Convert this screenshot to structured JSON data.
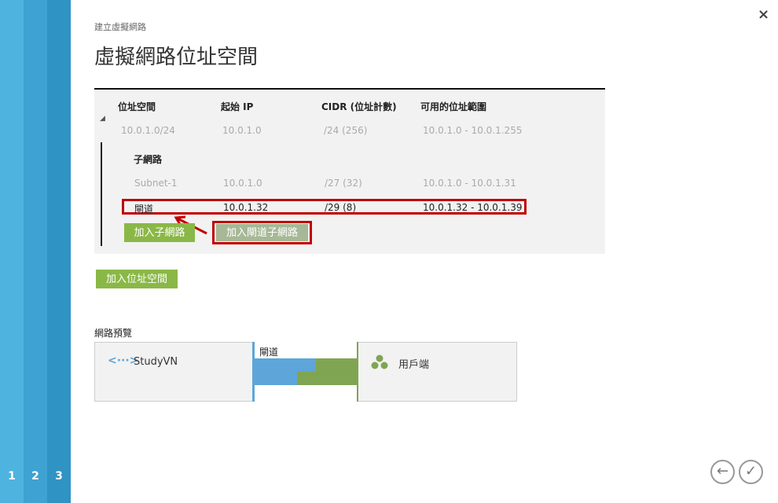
{
  "steps": [
    "1",
    "2",
    "3"
  ],
  "breadcrumb": "建立虛擬網路",
  "title": "虛擬網路位址空間",
  "close": "×",
  "headers": [
    "位址空間",
    "起始 IP",
    "CIDR (位址計數)",
    "可用的位址範圍"
  ],
  "address_space": {
    "name": "10.0.1.0/24",
    "start": "10.0.1.0",
    "cidr": "/24 (256)",
    "range": "10.0.1.0 - 10.0.1.255"
  },
  "subnet_label": "子網路",
  "subnets": [
    {
      "name": "Subnet-1",
      "start": "10.0.1.0",
      "cidr": "/27 (32)",
      "range": "10.0.1.0 - 10.0.1.31"
    },
    {
      "name": "閘道",
      "start": "10.0.1.32",
      "cidr": "/29 (8)",
      "range": "10.0.1.32 - 10.0.1.39"
    }
  ],
  "buttons": {
    "add_subnet": "加入子網路",
    "add_gateway_subnet": "加入閘道子網路",
    "add_address_space": "加入位址空間"
  },
  "preview": {
    "label": "網路預覽",
    "vnet": "StudyVN",
    "gateway": "閘道",
    "clients": "用戶端"
  },
  "colors": {
    "green": "#8ab846",
    "blue": "#5ea5d9",
    "highlight": "#c00000"
  }
}
